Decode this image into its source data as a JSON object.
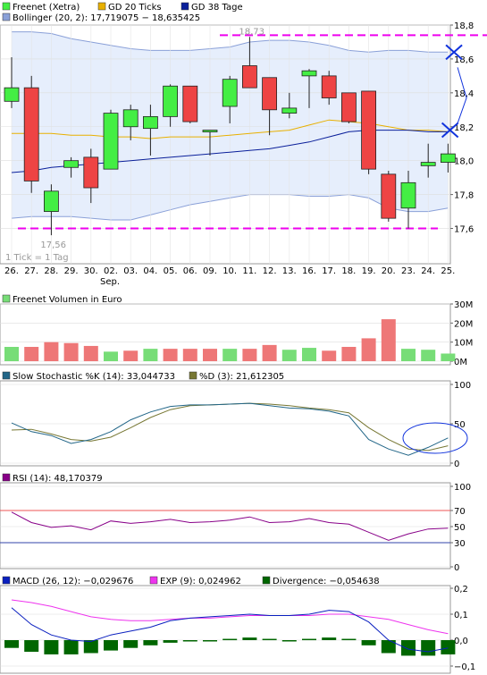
{
  "colors": {
    "up": "#44ee44",
    "down": "#ee4444",
    "gd20": "#e8b000",
    "gd38": "#0a1f9a",
    "bollinger": "#8aa0d8",
    "bollinger_fill": "#e6eefc",
    "dash": "#ee00ee",
    "marker": "#1133dd",
    "vol_up": "#77dd77",
    "vol_down": "#ee7777",
    "stoch_k": "#226688",
    "stoch_d": "#777733",
    "rsi": "#880088",
    "macd": "#0a1fbf",
    "exp": "#ee33ee",
    "divergence": "#006600",
    "ref70": "#ee5555",
    "ref30": "#3344aa"
  },
  "chart_data": [
    {
      "type": "candlestick",
      "legend": [
        {
          "name": "Freenet (Xetra)",
          "color": "#44ee44"
        },
        {
          "name": "GD 20 Ticks",
          "color": "#e8b000"
        },
        {
          "name": "GD 38 Tage",
          "color": "#0a1f9a"
        },
        {
          "name": "Bollinger (20, 2): 17,719075 − 18,635425",
          "color": "#8aa0d8"
        }
      ],
      "note": "1 Tick = 1 Tag",
      "ylim": [
        17.55,
        18.8
      ],
      "yticks": [
        17.6,
        17.8,
        18.0,
        18.2,
        18.4,
        18.6,
        18.8
      ],
      "ytick_labels": [
        "17,6",
        "17,8",
        "18,0",
        "18,2",
        "18,4",
        "18,6",
        "18,8"
      ],
      "categories": [
        "26.",
        "27.",
        "28.",
        "29.",
        "30.",
        "02.",
        "03.",
        "04.",
        "05.",
        "06.",
        "09.",
        "10.",
        "11.",
        "12.",
        "13.",
        "16.",
        "17.",
        "18.",
        "19.",
        "20.",
        "23.",
        "24.",
        "25."
      ],
      "month_label": "Sep.",
      "month_label_index": 5,
      "candles": [
        {
          "o": 18.35,
          "h": 18.61,
          "l": 18.31,
          "c": 18.43
        },
        {
          "o": 18.43,
          "h": 18.5,
          "l": 17.81,
          "c": 17.88
        },
        {
          "o": 17.7,
          "h": 17.86,
          "l": 17.56,
          "c": 17.82
        },
        {
          "o": 17.96,
          "h": 18.02,
          "l": 17.9,
          "c": 18.0
        },
        {
          "o": 18.02,
          "h": 18.07,
          "l": 17.75,
          "c": 17.84
        },
        {
          "o": 17.95,
          "h": 18.3,
          "l": 17.95,
          "c": 18.28
        },
        {
          "o": 18.2,
          "h": 18.33,
          "l": 18.12,
          "c": 18.3
        },
        {
          "o": 18.19,
          "h": 18.33,
          "l": 18.03,
          "c": 18.26
        },
        {
          "o": 18.26,
          "h": 18.45,
          "l": 18.2,
          "c": 18.44
        },
        {
          "o": 18.44,
          "h": 18.44,
          "l": 18.22,
          "c": 18.23
        },
        {
          "o": 18.18,
          "h": 18.18,
          "l": 18.03,
          "c": 18.18
        },
        {
          "o": 18.32,
          "h": 18.5,
          "l": 18.22,
          "c": 18.48
        },
        {
          "o": 18.56,
          "h": 18.73,
          "l": 18.45,
          "c": 18.43
        },
        {
          "o": 18.49,
          "h": 18.49,
          "l": 18.15,
          "c": 18.3
        },
        {
          "o": 18.28,
          "h": 18.4,
          "l": 18.25,
          "c": 18.31
        },
        {
          "o": 18.5,
          "h": 18.54,
          "l": 18.31,
          "c": 18.53
        },
        {
          "o": 18.5,
          "h": 18.53,
          "l": 18.33,
          "c": 18.37
        },
        {
          "o": 18.4,
          "h": 18.4,
          "l": 18.22,
          "c": 18.23
        },
        {
          "o": 18.41,
          "h": 18.41,
          "l": 17.92,
          "c": 17.95
        },
        {
          "o": 17.92,
          "h": 17.94,
          "l": 17.64,
          "c": 17.66
        },
        {
          "o": 17.72,
          "h": 17.94,
          "l": 17.6,
          "c": 17.87
        },
        {
          "o": 17.97,
          "h": 18.1,
          "l": 17.9,
          "c": 17.99
        },
        {
          "o": 17.99,
          "h": 18.1,
          "l": 17.93,
          "c": 18.04
        }
      ],
      "gd20": [
        18.16,
        18.16,
        18.16,
        18.15,
        18.15,
        18.14,
        18.14,
        18.13,
        18.14,
        18.14,
        18.14,
        18.15,
        18.16,
        18.17,
        18.18,
        18.21,
        18.24,
        18.23,
        18.22,
        18.2,
        18.18,
        18.18,
        18.17
      ],
      "gd38": [
        17.93,
        17.94,
        17.96,
        17.97,
        17.98,
        17.99,
        18.0,
        18.01,
        18.02,
        18.03,
        18.04,
        18.05,
        18.06,
        18.07,
        18.09,
        18.11,
        18.14,
        18.17,
        18.18,
        18.18,
        18.18,
        18.17,
        18.17
      ],
      "boll_upper": [
        18.76,
        18.76,
        18.75,
        18.72,
        18.7,
        18.68,
        18.66,
        18.65,
        18.65,
        18.65,
        18.66,
        18.67,
        18.7,
        18.71,
        18.71,
        18.7,
        18.68,
        18.65,
        18.64,
        18.65,
        18.65,
        18.64,
        18.64
      ],
      "boll_lower": [
        17.66,
        17.67,
        17.67,
        17.67,
        17.66,
        17.65,
        17.65,
        17.68,
        17.71,
        17.74,
        17.76,
        17.78,
        17.8,
        17.8,
        17.8,
        17.79,
        17.79,
        17.8,
        17.78,
        17.72,
        17.7,
        17.7,
        17.72
      ],
      "high_label": "18,73",
      "low_label": "17,56",
      "dash_high": 18.74,
      "dash_low": 17.6,
      "markers": [
        {
          "index": 22.3,
          "value": 18.64
        },
        {
          "index": 22.1,
          "value": 18.18
        }
      ]
    },
    {
      "type": "bar",
      "title": "Freenet Volumen in Euro",
      "ylim": [
        0,
        30
      ],
      "yticks": [
        0,
        10,
        20,
        30
      ],
      "ytick_labels": [
        "0M",
        "10M",
        "20M",
        "30M"
      ],
      "values": [
        7.5,
        7.5,
        10,
        9.5,
        8,
        5,
        5.5,
        6.5,
        6.5,
        6.5,
        6.5,
        6.5,
        6.5,
        8.5,
        6,
        7,
        5.5,
        7.5,
        12,
        22,
        6.5,
        6,
        4
      ],
      "colors": [
        "up",
        "down",
        "down",
        "down",
        "down",
        "up",
        "down",
        "up",
        "down",
        "down",
        "down",
        "up",
        "down",
        "down",
        "up",
        "up",
        "down",
        "down",
        "down",
        "down",
        "up",
        "up",
        "up"
      ]
    },
    {
      "type": "line",
      "legend": [
        {
          "name": "Slow Stochastic %K (14): 33,044733",
          "color": "#226688"
        },
        {
          "name": "%D (3): 21,612305",
          "color": "#777733"
        }
      ],
      "ylim": [
        0,
        100
      ],
      "yticks": [
        0,
        50,
        100
      ],
      "ytick_labels": [
        "0",
        "50",
        "100"
      ],
      "series": [
        {
          "name": "%K",
          "values": [
            51,
            40,
            35,
            25,
            30,
            40,
            55,
            65,
            72,
            74,
            74,
            75,
            76,
            73,
            70,
            69,
            66,
            60,
            30,
            18,
            10,
            20,
            32
          ]
        },
        {
          "name": "%D",
          "values": [
            42,
            43,
            37,
            30,
            28,
            33,
            45,
            58,
            68,
            73,
            74,
            75,
            76,
            75,
            73,
            70,
            68,
            64,
            45,
            30,
            18,
            16,
            22
          ]
        }
      ]
    },
    {
      "type": "line",
      "legend": [
        {
          "name": "RSI (14): 48,170379",
          "color": "#880088"
        }
      ],
      "ylim": [
        0,
        100
      ],
      "yticks": [
        0,
        30,
        50,
        70,
        100
      ],
      "ytick_labels": [
        "0",
        "30",
        "50",
        "70",
        "100"
      ],
      "series": [
        {
          "name": "RSI",
          "values": [
            68,
            55,
            49,
            51,
            46,
            57,
            54,
            56,
            59,
            55,
            56,
            58,
            62,
            55,
            56,
            60,
            55,
            53,
            43,
            33,
            41,
            47,
            48
          ]
        }
      ]
    },
    {
      "type": "line",
      "legend": [
        {
          "name": "MACD (26, 12): −0,029676",
          "color": "#0a1fbf"
        },
        {
          "name": "EXP (9): 0,024962",
          "color": "#ee33ee"
        },
        {
          "name": "Divergence: −0,054638",
          "color": "#006600"
        }
      ],
      "ylim": [
        -0.1,
        0.2
      ],
      "yticks": [
        -0.1,
        0.0,
        0.1,
        0.2
      ],
      "ytick_labels": [
        "−0,1",
        "0,0",
        "0,1",
        "0,2"
      ],
      "series": [
        {
          "name": "MACD",
          "values": [
            0.125,
            0.06,
            0.02,
            0.0,
            -0.005,
            0.02,
            0.035,
            0.05,
            0.075,
            0.085,
            0.09,
            0.095,
            0.1,
            0.095,
            0.095,
            0.1,
            0.115,
            0.11,
            0.07,
            0.0,
            -0.035,
            -0.045,
            -0.03
          ]
        },
        {
          "name": "EXP",
          "values": [
            0.155,
            0.145,
            0.13,
            0.11,
            0.09,
            0.08,
            0.075,
            0.075,
            0.08,
            0.085,
            0.085,
            0.09,
            0.095,
            0.095,
            0.095,
            0.095,
            0.1,
            0.1,
            0.09,
            0.08,
            0.06,
            0.04,
            0.025
          ]
        },
        {
          "name": "Divergence",
          "values": [
            -0.03,
            -0.045,
            -0.055,
            -0.055,
            -0.05,
            -0.04,
            -0.03,
            -0.02,
            -0.01,
            -0.005,
            -0.005,
            0.005,
            0.01,
            0.005,
            -0.005,
            0.005,
            0.01,
            0.005,
            -0.02,
            -0.05,
            -0.06,
            -0.06,
            -0.055
          ]
        }
      ]
    }
  ]
}
